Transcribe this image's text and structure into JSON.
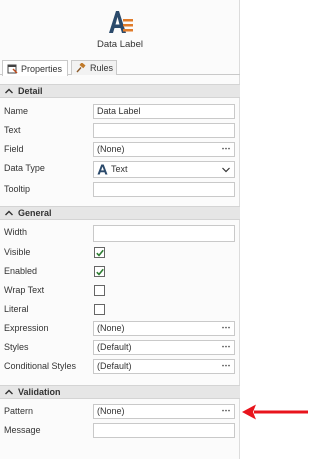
{
  "header": {
    "title": "Data Label",
    "icon": "data-label-icon"
  },
  "tabs": [
    {
      "label": "Properties",
      "icon": "properties-icon",
      "active": true
    },
    {
      "label": "Rules",
      "icon": "gavel-icon",
      "active": false
    }
  ],
  "sections": {
    "detail": {
      "title": "Detail",
      "rows": {
        "name": {
          "label": "Name",
          "value": "Data Label"
        },
        "text": {
          "label": "Text",
          "value": ""
        },
        "field": {
          "label": "Field",
          "value": "(None)",
          "button": "⋯"
        },
        "data_type": {
          "label": "Data Type",
          "value": "Text",
          "icon": "text-type-icon"
        },
        "tooltip": {
          "label": "Tooltip",
          "value": ""
        }
      }
    },
    "general": {
      "title": "General",
      "rows": {
        "width": {
          "label": "Width",
          "value": ""
        },
        "visible": {
          "label": "Visible",
          "checked": true
        },
        "enabled": {
          "label": "Enabled",
          "checked": true
        },
        "wrap_text": {
          "label": "Wrap Text",
          "checked": false
        },
        "literal": {
          "label": "Literal",
          "checked": false
        },
        "expression": {
          "label": "Expression",
          "value": "(None)",
          "button": "⋯"
        },
        "styles": {
          "label": "Styles",
          "value": "(Default)",
          "button": "⋯"
        },
        "conditional_styles": {
          "label": "Conditional Styles",
          "value": "(Default)",
          "button": "⋯"
        }
      }
    },
    "validation": {
      "title": "Validation",
      "rows": {
        "pattern": {
          "label": "Pattern",
          "value": "(None)",
          "button": "⋯"
        },
        "message": {
          "label": "Message",
          "value": ""
        }
      }
    }
  },
  "colors": {
    "check": "#2e7d32",
    "arrow": "#e8141c",
    "type_icon": "#2b4a6b",
    "header_icon_accent": "#e07b2a"
  }
}
